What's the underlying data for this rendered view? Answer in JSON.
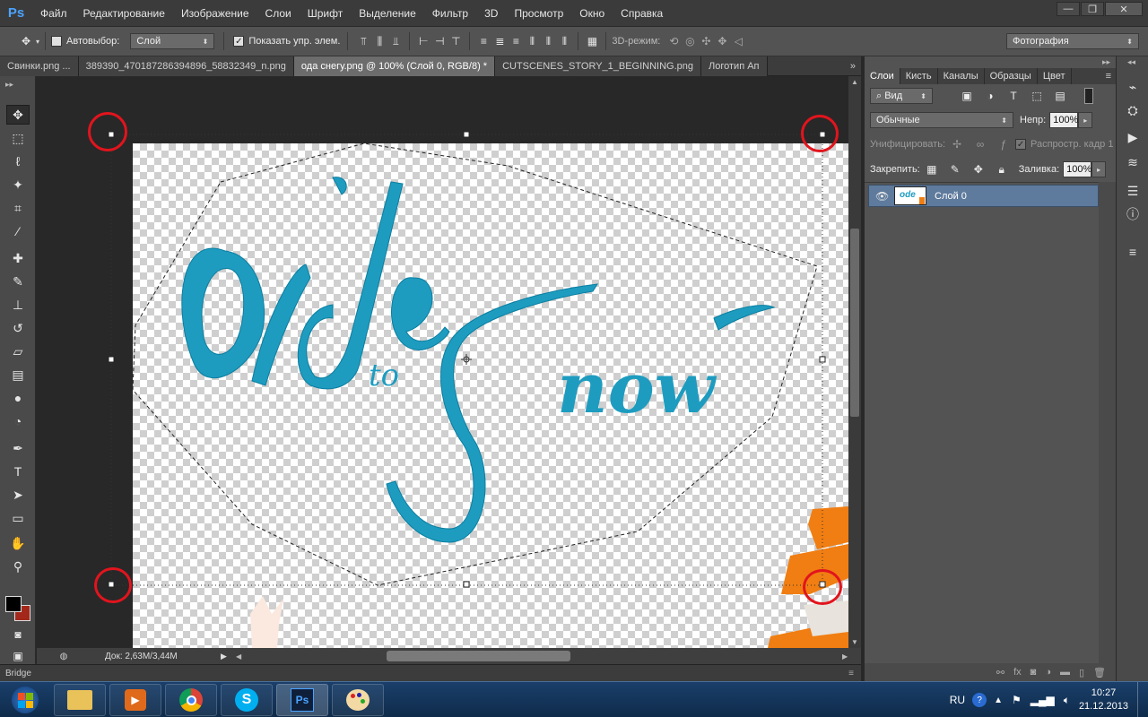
{
  "app": {
    "logo": "Ps"
  },
  "menu": [
    "Файл",
    "Редактирование",
    "Изображение",
    "Слои",
    "Шрифт",
    "Выделение",
    "Фильтр",
    "3D",
    "Просмотр",
    "Окно",
    "Справка"
  ],
  "window_controls": [
    "—",
    "❐",
    "✕"
  ],
  "options": {
    "autoselect_label": "Автовыбор:",
    "autoselect_value": "Слой",
    "show_controls_label": "Показать упр. элем.",
    "mode_3d_label": "3D-режим:",
    "workspace": "Фотография"
  },
  "tabs": [
    {
      "label": "Свинки.png ...",
      "active": false
    },
    {
      "label": "389390_470187286394896_58832349_n.png",
      "active": false
    },
    {
      "label": "ода снегу.png @ 100% (Слой 0, RGB/8) *",
      "active": true
    },
    {
      "label": "CUTSCENES_STORY_1_BEGINNING.png",
      "active": false
    },
    {
      "label": "Логотип Ап",
      "active": false
    }
  ],
  "artwork": {
    "word1": "ode",
    "word2": "to",
    "word3": "Snow",
    "color": "#1e9cc0"
  },
  "status": {
    "doc_info": "Док: 2,63M/3,44M"
  },
  "bridge_label": "Bridge",
  "panel": {
    "tabs": [
      "Слои",
      "Кисть",
      "Каналы",
      "Образцы",
      "Цвет"
    ],
    "filter_label": "Вид",
    "blend_mode": "Обычные",
    "opacity_label": "Непр:",
    "opacity_value": "100%",
    "unify_label": "Унифицировать:",
    "propagate_label": "Распростр. кадр 1",
    "lock_label": "Закрепить:",
    "fill_label": "Заливка:",
    "fill_value": "100%",
    "layer_name": "Слой 0"
  },
  "taskbar": {
    "lang": "RU",
    "time": "10:27",
    "date": "21.12.2013",
    "apps": [
      "explorer",
      "media-player",
      "chrome",
      "skype",
      "photoshop",
      "paint"
    ]
  },
  "colors": {
    "accent_ring": "#e2141d",
    "selection": "#5e7a9c",
    "lettering": "#1e9cc0",
    "orange": "#f07e12"
  }
}
